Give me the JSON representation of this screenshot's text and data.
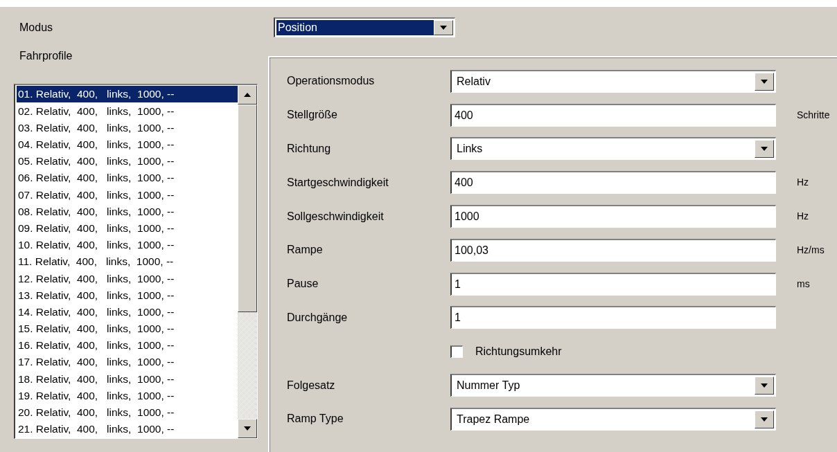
{
  "modus": {
    "label": "Modus",
    "value": "Position",
    "focused": true
  },
  "profiles": {
    "label": "Fahrprofile",
    "items": [
      {
        "text": "01. Relativ,  400,   links,  1000, --",
        "selected": true
      },
      {
        "text": "02. Relativ,  400,   links,  1000, --",
        "selected": false
      },
      {
        "text": "03. Relativ,  400,   links,  1000, --",
        "selected": false
      },
      {
        "text": "04. Relativ,  400,   links,  1000, --",
        "selected": false
      },
      {
        "text": "05. Relativ,  400,   links,  1000, --",
        "selected": false
      },
      {
        "text": "06. Relativ,  400,   links,  1000, --",
        "selected": false
      },
      {
        "text": "07. Relativ,  400,   links,  1000, --",
        "selected": false
      },
      {
        "text": "08. Relativ,  400,   links,  1000, --",
        "selected": false
      },
      {
        "text": "09. Relativ,  400,   links,  1000, --",
        "selected": false
      },
      {
        "text": "10. Relativ,  400,   links,  1000, --",
        "selected": false
      },
      {
        "text": "11. Relativ,  400,   links,  1000, --",
        "selected": false
      },
      {
        "text": "12. Relativ,  400,   links,  1000, --",
        "selected": false
      },
      {
        "text": "13. Relativ,  400,   links,  1000, --",
        "selected": false
      },
      {
        "text": "14. Relativ,  400,   links,  1000, --",
        "selected": false
      },
      {
        "text": "15. Relativ,  400,   links,  1000, --",
        "selected": false
      },
      {
        "text": "16. Relativ,  400,   links,  1000, --",
        "selected": false
      },
      {
        "text": "17. Relativ,  400,   links,  1000, --",
        "selected": false
      },
      {
        "text": "18. Relativ,  400,   links,  1000, --",
        "selected": false
      },
      {
        "text": "19. Relativ,  400,   links,  1000, --",
        "selected": false
      },
      {
        "text": "20. Relativ,  400,   links,  1000, --",
        "selected": false
      },
      {
        "text": "21. Relativ,  400,   links,  1000, --",
        "selected": false
      }
    ]
  },
  "form": [
    {
      "kind": "dropdown",
      "label": "Operationsmodus",
      "value": "Relativ"
    },
    {
      "kind": "text",
      "label": "Stellgröße",
      "value": "400",
      "unit": "Schritte"
    },
    {
      "kind": "dropdown",
      "label": "Richtung",
      "value": "Links"
    },
    {
      "kind": "text",
      "label": "Startgeschwindigkeit",
      "value": "400",
      "unit": "Hz"
    },
    {
      "kind": "text",
      "label": "Sollgeschwindigkeit",
      "value": "1000",
      "unit": "Hz"
    },
    {
      "kind": "text",
      "label": "Rampe",
      "value": "100,03",
      "unit": "Hz/ms"
    },
    {
      "kind": "text",
      "label": "Pause",
      "value": "1",
      "unit": "ms"
    },
    {
      "kind": "text",
      "label": "Durchgänge",
      "value": "1"
    },
    {
      "kind": "checkbox",
      "label": "Richtungsumkehr",
      "checked": false
    },
    {
      "kind": "dropdown",
      "label": "Folgesatz",
      "value": "Nummer Typ"
    },
    {
      "kind": "dropdown",
      "label": "Ramp Type",
      "value": "Trapez Rampe"
    }
  ]
}
